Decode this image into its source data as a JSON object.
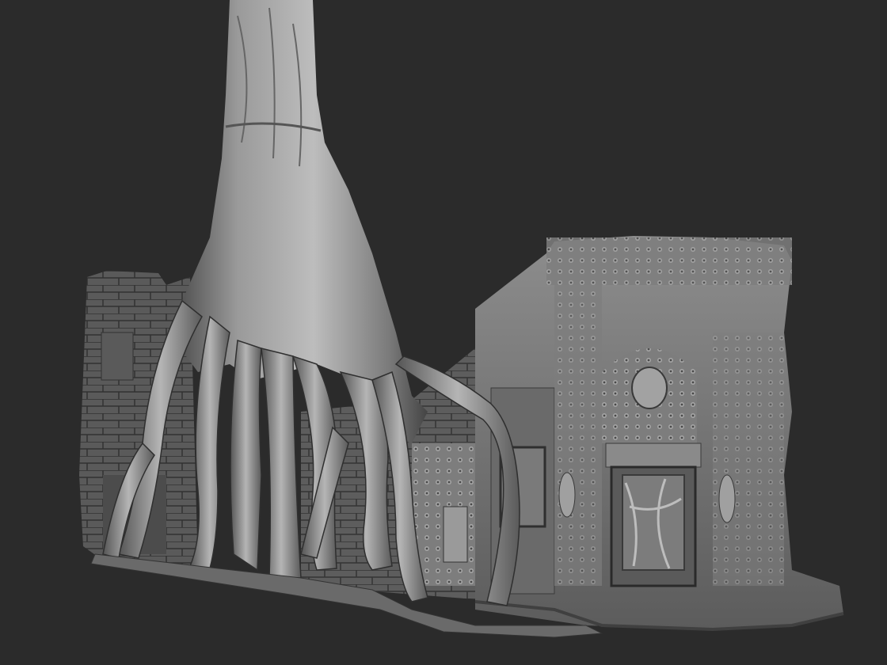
{
  "viewport": {
    "background": "#2b2b2b",
    "material": "matcap-grey-clay"
  },
  "model": {
    "subject": "tree-roots-over-temple-ruin",
    "colors": {
      "highlight": "#c9c9c9",
      "mid": "#8a8a8a",
      "shadow": "#3a3a3a",
      "deep": "#1f1f1f"
    }
  }
}
